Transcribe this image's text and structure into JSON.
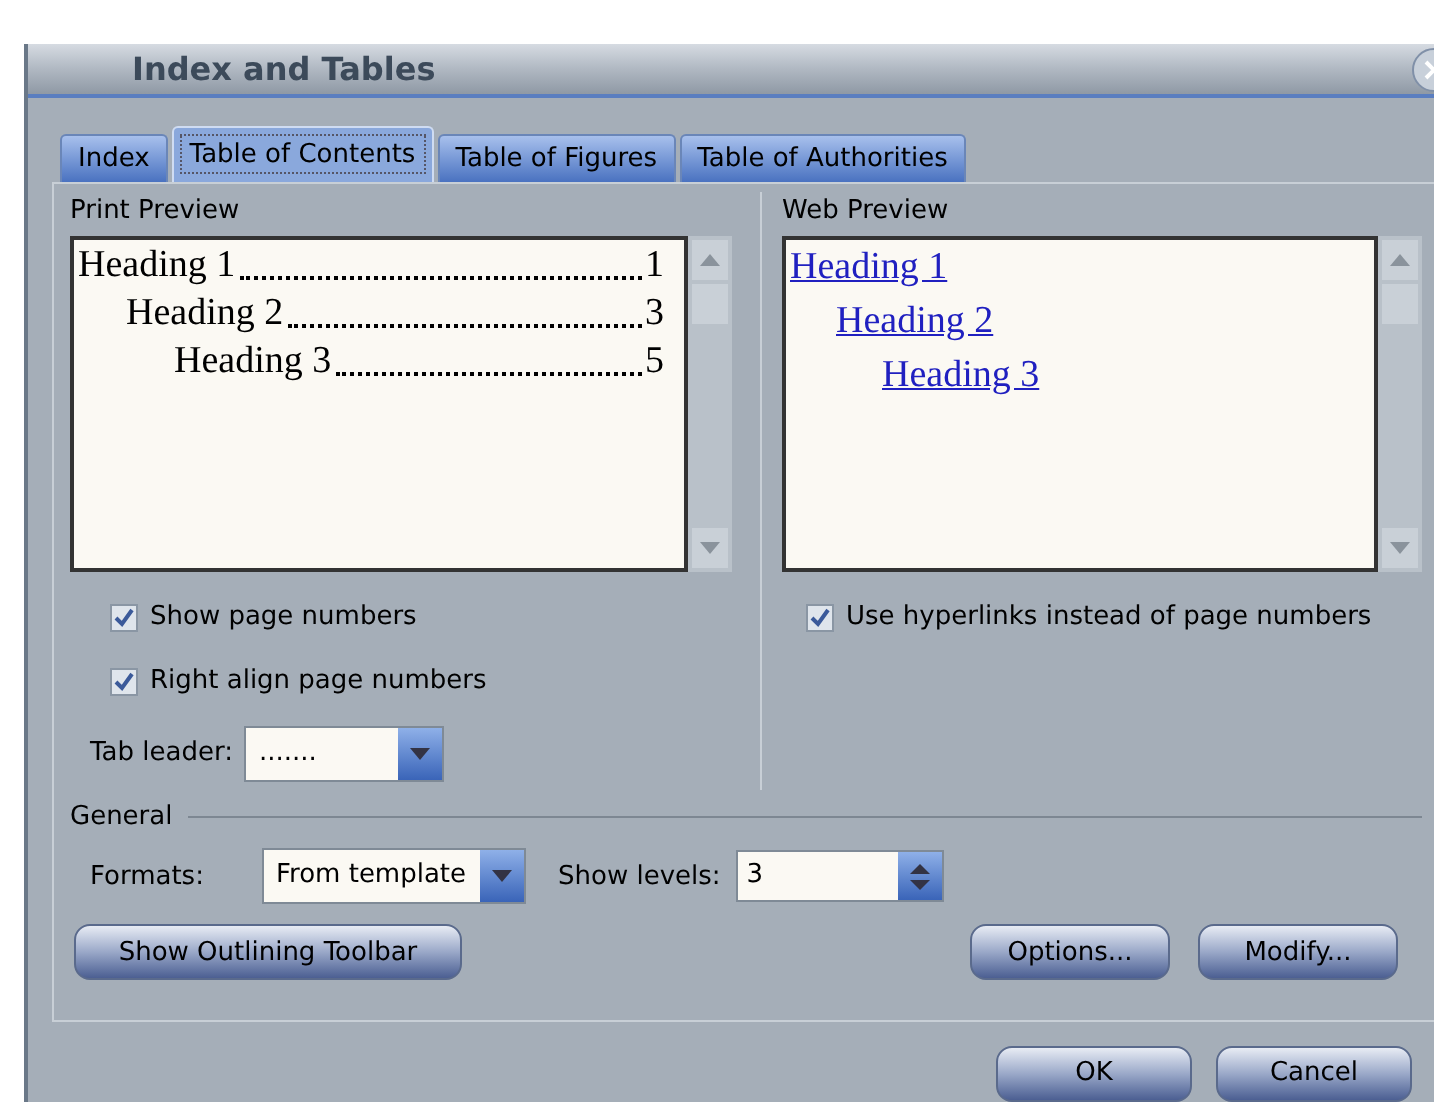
{
  "window": {
    "title": "Index and Tables"
  },
  "tabs": [
    {
      "label": "Index",
      "selected": false
    },
    {
      "label": "Table of Contents",
      "selected": true
    },
    {
      "label": "Table of Figures",
      "selected": false
    },
    {
      "label": "Table of Authorities",
      "selected": false
    }
  ],
  "print_preview": {
    "label": "Print Preview",
    "entries": [
      {
        "text": "Heading 1",
        "page": "1",
        "children": [
          {
            "text": "Heading 2",
            "page": "3",
            "children": [
              {
                "text": "Heading 3",
                "page": "5"
              }
            ]
          }
        ]
      }
    ]
  },
  "web_preview": {
    "label": "Web Preview",
    "entries": [
      {
        "text": "Heading 1",
        "children": [
          {
            "text": "Heading 2",
            "children": [
              {
                "text": "Heading 3"
              }
            ]
          }
        ]
      }
    ]
  },
  "left_options": [
    {
      "label": "Show page numbers",
      "checked": true
    },
    {
      "label": "Right align page numbers",
      "checked": true
    }
  ],
  "right_options": [
    {
      "label": "Use hyperlinks instead of page numbers",
      "checked": true
    }
  ],
  "tab_leader": {
    "label": "Tab leader:",
    "value": "......."
  },
  "general": {
    "label": "General",
    "formats": {
      "label": "Formats:",
      "value": "From template"
    },
    "show_levels": {
      "label": "Show levels:",
      "value": "3"
    }
  },
  "buttons": [
    {
      "label": "Show Outlining Toolbar"
    },
    {
      "label": "Options..."
    },
    {
      "label": "Modify..."
    }
  ],
  "footer_buttons": [
    {
      "label": "OK"
    },
    {
      "label": "Cancel"
    }
  ]
}
